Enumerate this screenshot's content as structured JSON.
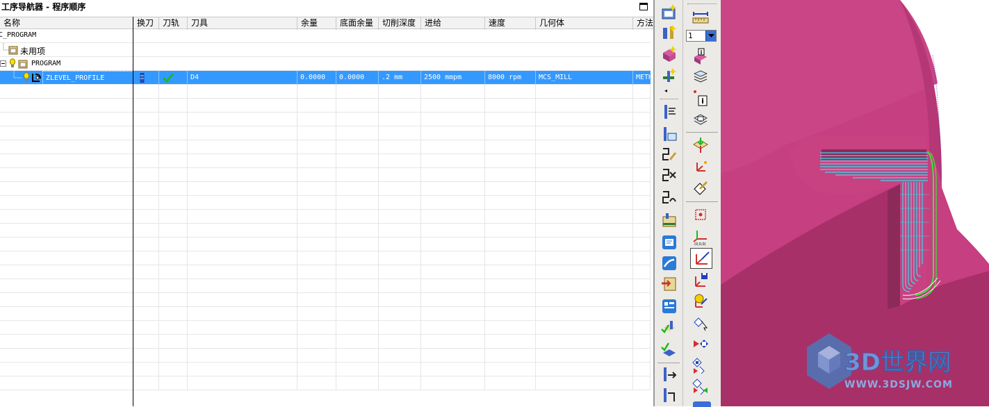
{
  "navigator": {
    "title": "工序导航器 - 程序顺序",
    "columns": [
      "名称",
      "换刀",
      "刀轨",
      "刀具",
      "余量",
      "底面余量",
      "切削深度",
      "进给",
      "速度",
      "几何体",
      "方法"
    ],
    "tree": {
      "root": "NC_PROGRAM",
      "unused": "未用项",
      "program": "PROGRAM"
    },
    "operation": {
      "name": "ZLEVEL_PROFILE",
      "tool": "D4",
      "stock": "0.0000",
      "floor_stock": "0.0000",
      "depth": ".2 mm",
      "feed": "2500 mmpm",
      "speed": "8000 rpm",
      "geometry": "MCS_MILL",
      "method": "METHOD"
    },
    "empty_rows": 22
  },
  "toolbar": {
    "layer_value": "1"
  },
  "colors": {
    "selection": "#3399ff",
    "part": "#c63f80",
    "part_dark": "#9b2f63",
    "toolpath": "#3fd8e8",
    "toolpath_green": "#33ee33"
  },
  "watermark": {
    "brand": "3D世界网",
    "url": "WWW.3DSJW.COM"
  }
}
